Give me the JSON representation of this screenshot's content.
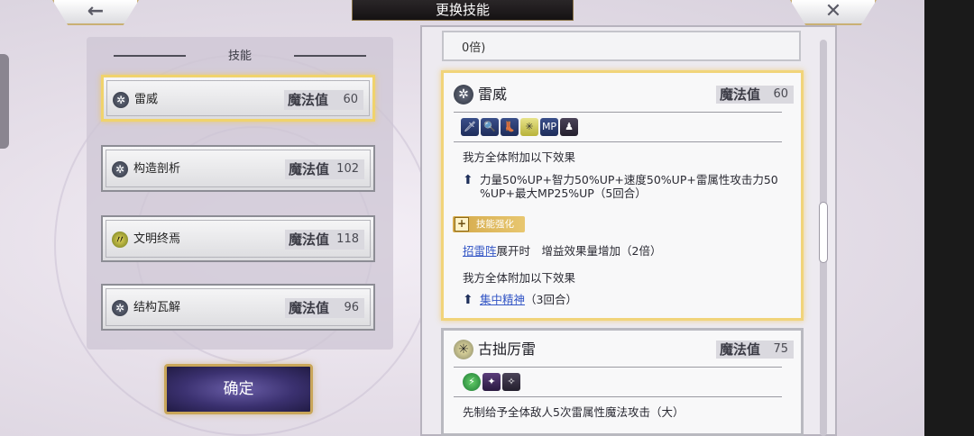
{
  "header": {
    "title": "更换技能",
    "back_icon": "←",
    "close_icon": "✕"
  },
  "skill_list": {
    "heading": "技能",
    "items": [
      {
        "name": "雷威",
        "mp_label": "魔法值",
        "mp": "60",
        "icon": "✲",
        "selected": true
      },
      {
        "name": "构造剖析",
        "mp_label": "魔法值",
        "mp": "102",
        "icon": "✲",
        "selected": false
      },
      {
        "name": "文明终焉",
        "mp_label": "魔法值",
        "mp": "118",
        "icon": "〃",
        "selected": false
      },
      {
        "name": "结构瓦解",
        "mp_label": "魔法值",
        "mp": "96",
        "icon": "✲",
        "selected": false
      }
    ]
  },
  "confirm_label": "确定",
  "detail": {
    "prev_tail": "0倍)",
    "skill1": {
      "name": "雷威",
      "icon": "✲",
      "mp_label": "魔法值",
      "mp": "60",
      "buff_icons": [
        "🗡",
        "🔍",
        "👢",
        "✳",
        "MP",
        "♟"
      ],
      "effect_intro": "我方全体附加以下效果",
      "effect_line1": "力量50%UP+智力50%UP+速度50%UP+雷属性攻击力50",
      "effect_line2": "%UP+最大MP25%UP（5回合）",
      "enhance_label": "技能强化",
      "cond_link": "招雷阵",
      "cond_text": "展开时　增益效果量增加（2倍）",
      "effect2_intro": "我方全体附加以下效果",
      "effect2_link": "集中精神",
      "effect2_tail": "（3回合）"
    },
    "skill2": {
      "name": "古拙厉雷",
      "icon": "✳",
      "mp_label": "魔法值",
      "mp": "75",
      "buff_icons": [
        "⚡",
        "✦",
        "✧"
      ],
      "effect_intro": "先制给予全体敌人5次雷属性魔法攻击（大）"
    }
  }
}
